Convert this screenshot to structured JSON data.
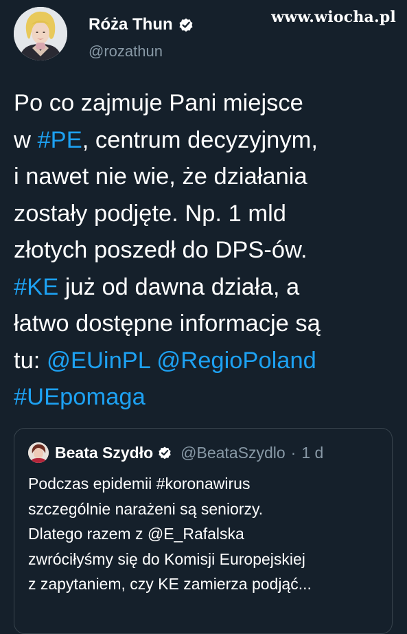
{
  "watermark": "www.wiocha.pl",
  "tweet": {
    "author": {
      "name": "Róża Thun",
      "handle": "@rozathun",
      "avatar": "avatar-photo"
    },
    "lines": [
      [
        {
          "t": "Po co zajmuje Pani miejsce"
        }
      ],
      [
        {
          "t": "w "
        },
        {
          "t": "#PE",
          "link": true
        },
        {
          "t": ", centrum decyzyjnym,"
        }
      ],
      [
        {
          "t": "i nawet nie wie, że działania"
        }
      ],
      [
        {
          "t": "zostały podjęte. Np. 1 mld"
        }
      ],
      [
        {
          "t": "złotych poszedł do DPS-ów."
        }
      ],
      [
        {
          "t": "#KE",
          "link": true
        },
        {
          "t": " już od dawna działa, a"
        }
      ],
      [
        {
          "t": "łatwo dostępne informacje są"
        }
      ],
      [
        {
          "t": "tu: "
        },
        {
          "t": "@EUinPL",
          "link": true
        },
        {
          "t": " "
        },
        {
          "t": "@RegioPoland",
          "link": true
        }
      ],
      [
        {
          "t": "#UEpomaga",
          "link": true
        }
      ]
    ]
  },
  "quoted": {
    "name": "Beata Szydło",
    "handle": "@BeataSzydlo",
    "separator": "·",
    "time": "1 d",
    "lines": [
      "Podczas epidemii #koronawirus",
      "szczególnie narażeni są seniorzy.",
      "Dlatego razem z @E_Rafalska",
      "zwróciłyśmy się do Komisji Europejskiej",
      "z zapytaniem, czy KE zamierza podjąć..."
    ]
  },
  "colors": {
    "background": "#15202b",
    "link": "#1da1f2",
    "secondary_text": "#8899a6",
    "border": "#38444d"
  },
  "icons": {
    "verified": "verified-badge-icon"
  }
}
